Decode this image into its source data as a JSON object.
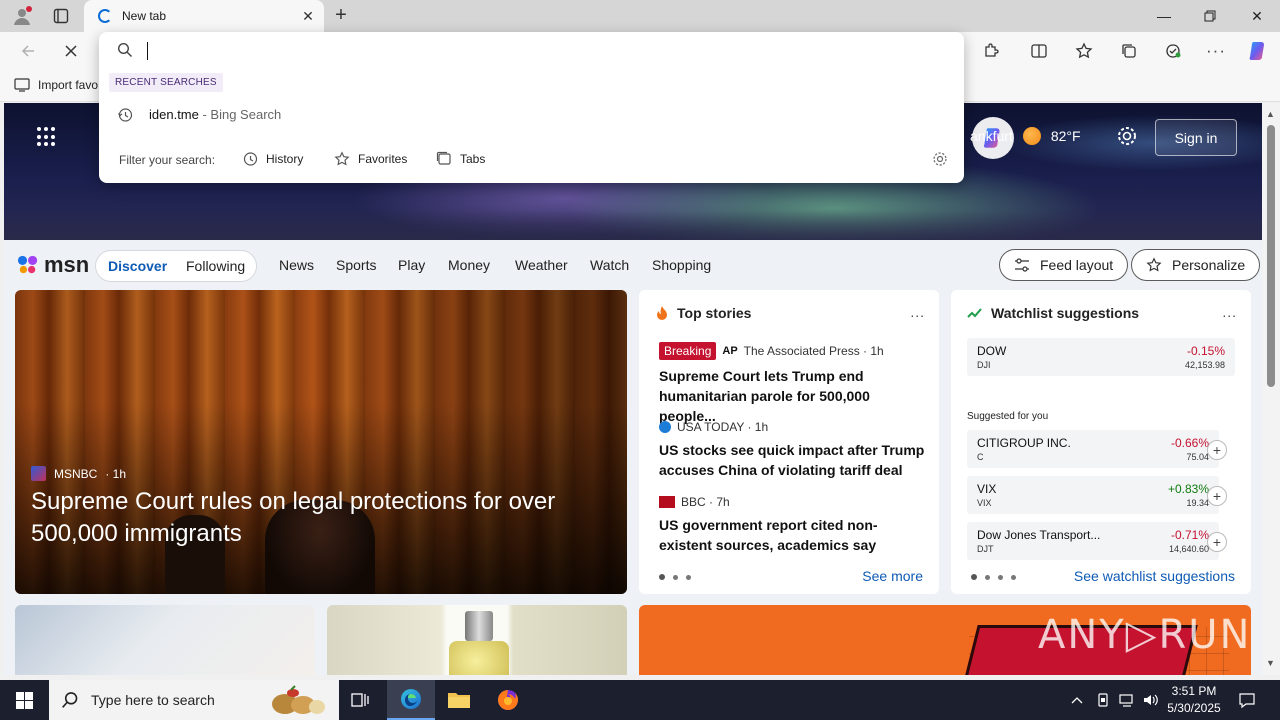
{
  "browser": {
    "tab_title": "New tab",
    "favorites_bar_item": "Import favo"
  },
  "omnibox": {
    "input_value": "",
    "recent_heading": "RECENT SEARCHES",
    "recent": [
      {
        "query": "iden.tme",
        "suffix": " - Bing Search"
      }
    ],
    "filter_label": "Filter your search:",
    "filters": [
      "History",
      "Favorites",
      "Tabs"
    ]
  },
  "msn": {
    "logo_text": "msn",
    "weather_city": "ankfurt",
    "weather_temp": "82°F",
    "sign_in": "Sign in",
    "tabs": {
      "discover": "Discover",
      "following": "Following"
    },
    "nav": [
      "News",
      "Sports",
      "Play",
      "Money",
      "Weather",
      "Watch",
      "Shopping"
    ],
    "feed_layout": "Feed layout",
    "personalize": "Personalize",
    "feature": {
      "source": "MSNBC",
      "age": "· 1h",
      "title": "Supreme Court rules on legal protections for over 500,000 immigrants"
    },
    "top_stories": {
      "title": "Top stories",
      "more": "...",
      "items": [
        {
          "badge": "Breaking",
          "logo": "AP",
          "source": "The Associated Press · 1h",
          "title": "Supreme Court lets Trump end humanitarian parole for 500,000 people..."
        },
        {
          "source": "USA TODAY · 1h",
          "title": "US stocks see quick impact after Trump accuses China of violating tariff deal"
        },
        {
          "source": "BBC · 7h",
          "title": "US government report cited non-existent sources, academics say"
        }
      ],
      "see_more": "See more"
    },
    "watchlist": {
      "title": "Watchlist suggestions",
      "more": "...",
      "main": {
        "name": "DOW",
        "symbol": "DJI",
        "change": "-0.15%",
        "price": "42,153.98",
        "trend": "neg"
      },
      "suggested_label": "Suggested for you",
      "suggestions": [
        {
          "name": "CITIGROUP INC.",
          "symbol": "C",
          "change": "-0.66%",
          "price": "75.04",
          "trend": "neg"
        },
        {
          "name": "VIX",
          "symbol": "VIX",
          "change": "+0.83%",
          "price": "19.34",
          "trend": "pos"
        },
        {
          "name": "Dow Jones Transport...",
          "symbol": "DJT",
          "change": "-0.71%",
          "price": "14,640.60",
          "trend": "neg"
        }
      ],
      "see_all": "See watchlist suggestions"
    }
  },
  "watermark": "ANY▷RUN",
  "taskbar": {
    "search_placeholder": "Type here to search",
    "time": "3:51 PM",
    "date": "5/30/2025"
  },
  "colors": {
    "accent_blue": "#0f5bb5",
    "negative": "#c4122f",
    "positive": "#0f7b0f",
    "breaking": "#c4122f"
  }
}
